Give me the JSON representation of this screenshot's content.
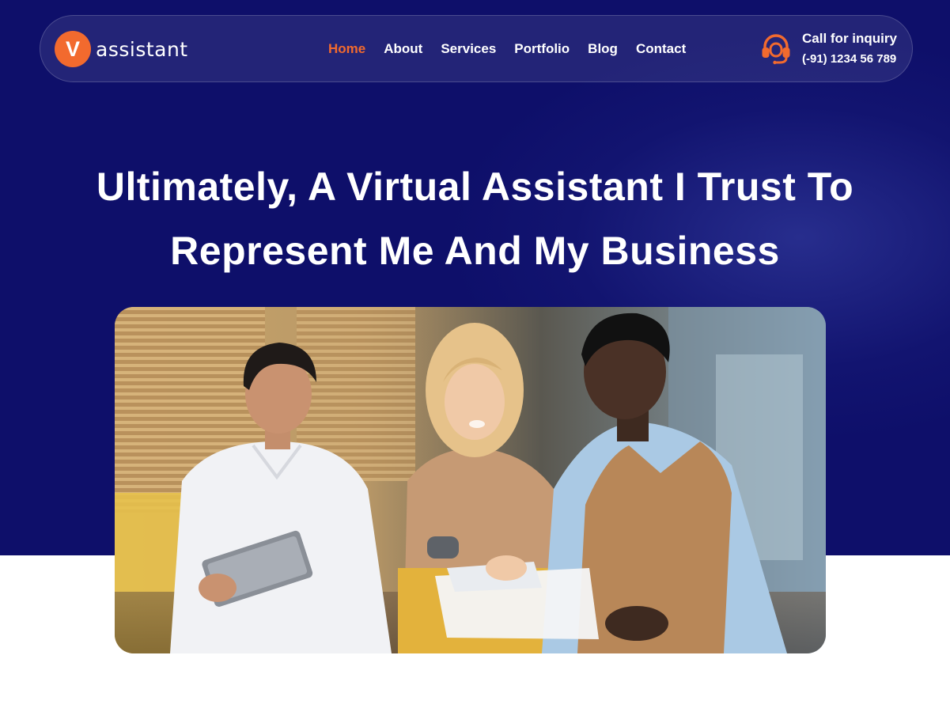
{
  "brand": {
    "logo_letter": "V",
    "name": "assistant",
    "accent_color": "#f26a2e",
    "background_color": "#0e0f6a"
  },
  "nav": {
    "items": [
      {
        "label": "Home",
        "active": true
      },
      {
        "label": "About",
        "active": false
      },
      {
        "label": "Services",
        "active": false
      },
      {
        "label": "Portfolio",
        "active": false
      },
      {
        "label": "Blog",
        "active": false
      },
      {
        "label": "Contact",
        "active": false
      }
    ]
  },
  "inquiry": {
    "icon": "headset-icon",
    "title": "Call for inquiry",
    "phone": "(-91) 1234 56 789"
  },
  "hero": {
    "headline_line1": "Ultimately, A Virtual Assistant I Trust To",
    "headline_line2": "Represent Me And My Business"
  }
}
